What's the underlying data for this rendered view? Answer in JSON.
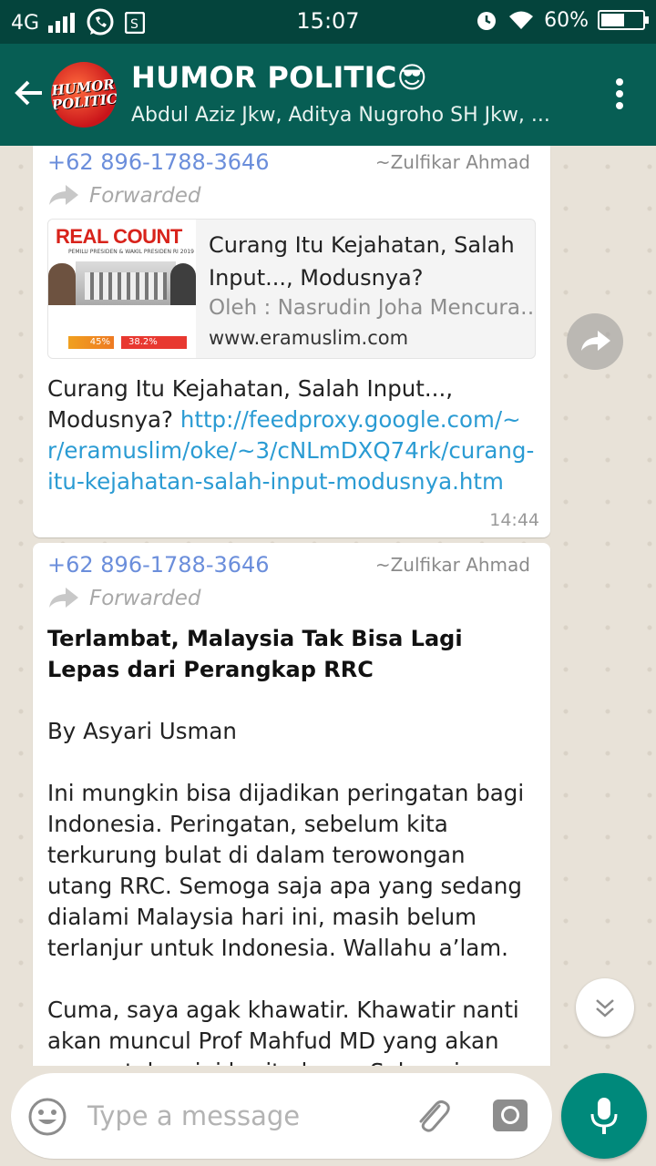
{
  "status_bar": {
    "network": "4G",
    "time": "15:07",
    "battery": "60%",
    "battery_level": 0.6,
    "icons": [
      "signal-icon",
      "whatsapp-icon",
      "sim-icon",
      "alarm-icon",
      "wifi-icon",
      "battery-icon"
    ]
  },
  "header": {
    "back_icon": "back-arrow-icon",
    "avatar_text": "HUMOR POLITIC",
    "title": "HUMOR POLITIC😎",
    "subtitle": "Abdul Aziz Jkw, Aditya Nugroho SH Jkw, ...",
    "menu_icon": "more-vert-icon"
  },
  "messages": [
    {
      "sender_phone": "+62 896-1788-3646",
      "sender_name": "~Zulfikar Ahmad",
      "forwarded_label": "Forwarded",
      "link_preview": {
        "thumb_heading": "REAL COUNT",
        "thumb_sub": "PEMILU PRESIDEN & WAKIL PRESIDEN RI 2019",
        "thumb_value_1": "45%",
        "thumb_value_2": "38.2%",
        "title": "Curang Itu Kejahatan, Salah Input..., Modusnya?",
        "description": "Oleh : Nasrudin Joha Mencurangi...",
        "domain": "www.eramuslim.com"
      },
      "text": "Curang Itu Kejahatan,  Salah Input..., Modusnya? ",
      "link": "http://feedproxy.google.com/~r/eramuslim/oke/~3/cNLmDXQ74rk/curang-itu-kejahatan-salah-input-modusnya.htm",
      "time": "14:44"
    },
    {
      "sender_phone": "+62 896-1788-3646",
      "sender_name": "~Zulfikar Ahmad",
      "forwarded_label": "Forwarded",
      "headline": "Terlambat, Malaysia Tak Bisa Lagi Lepas dari Perangkap RRC",
      "paragraphs": [
        "By Asyari Usman",
        "Ini mungkin bisa dijadikan peringatan bagi Indonesia. Peringatan, sebelum kita terkurung bulat di dalam terowongan utang RRC. Semoga saja apa yang sedang dialami Malaysia hari ini, masih belum terlanjur untuk Indonesia. Wallahu a’lam.",
        "Cuma, saya agak khawatir. Khawatir nanti akan muncul Prof Mahfud MD yang akan mengatakan ini berita hoax. Sebagaimana"
      ]
    }
  ],
  "floating": {
    "share_icon": "forward-share-icon",
    "scroll_icon": "scroll-down-icon"
  },
  "input": {
    "placeholder": "Type a message",
    "emoji_icon": "emoji-icon",
    "attach_icon": "attach-icon",
    "camera_icon": "camera-icon",
    "mic_icon": "mic-icon"
  }
}
